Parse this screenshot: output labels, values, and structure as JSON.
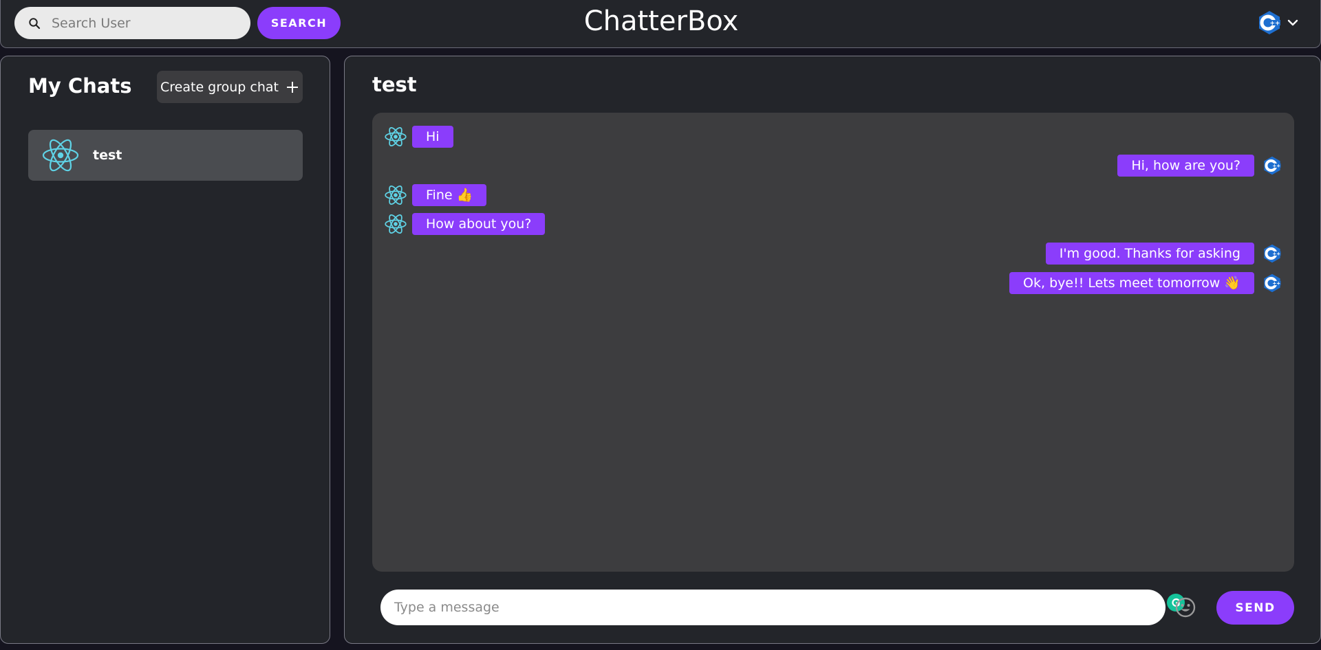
{
  "header": {
    "search_placeholder": "Search User",
    "search_button": "SEARCH",
    "app_title": "ChatterBox",
    "profile_icon": "cpp-logo-icon",
    "profile_menu_icon": "chevron-down-icon"
  },
  "sidebar": {
    "title": "My Chats",
    "create_group_label": "Create group chat",
    "create_group_icon": "plus-icon",
    "chats": [
      {
        "name": "test",
        "avatar": "react-logo-icon"
      }
    ]
  },
  "chat": {
    "title": "test",
    "messages": [
      {
        "direction": "incoming",
        "text": "Hi",
        "avatar": "react-logo-icon"
      },
      {
        "direction": "outgoing",
        "text": "Hi, how are you?",
        "avatar": "cpp-logo-icon"
      },
      {
        "direction": "incoming",
        "text": "Fine 👍",
        "avatar": "react-logo-icon"
      },
      {
        "direction": "incoming",
        "text": "How about you?",
        "avatar": "react-logo-icon"
      },
      {
        "direction": "outgoing",
        "text": "I'm good. Thanks for asking",
        "avatar": "cpp-logo-icon"
      },
      {
        "direction": "outgoing",
        "text": "Ok, bye!! Lets meet tomorrow 👋",
        "avatar": "cpp-logo-icon"
      }
    ],
    "composer": {
      "placeholder": "Type a message",
      "send_label": "SEND",
      "emoji_icon": "emoji-icon",
      "grammarly_icon": "grammarly-icon"
    }
  },
  "colors": {
    "accent": "#8b3dfb",
    "panel": "#23252a",
    "messages_bg": "#3d3d3f",
    "selected_chat": "#4a4c50",
    "react_cyan": "#5fd3e6",
    "cpp_blue": "#1e6fd0"
  }
}
